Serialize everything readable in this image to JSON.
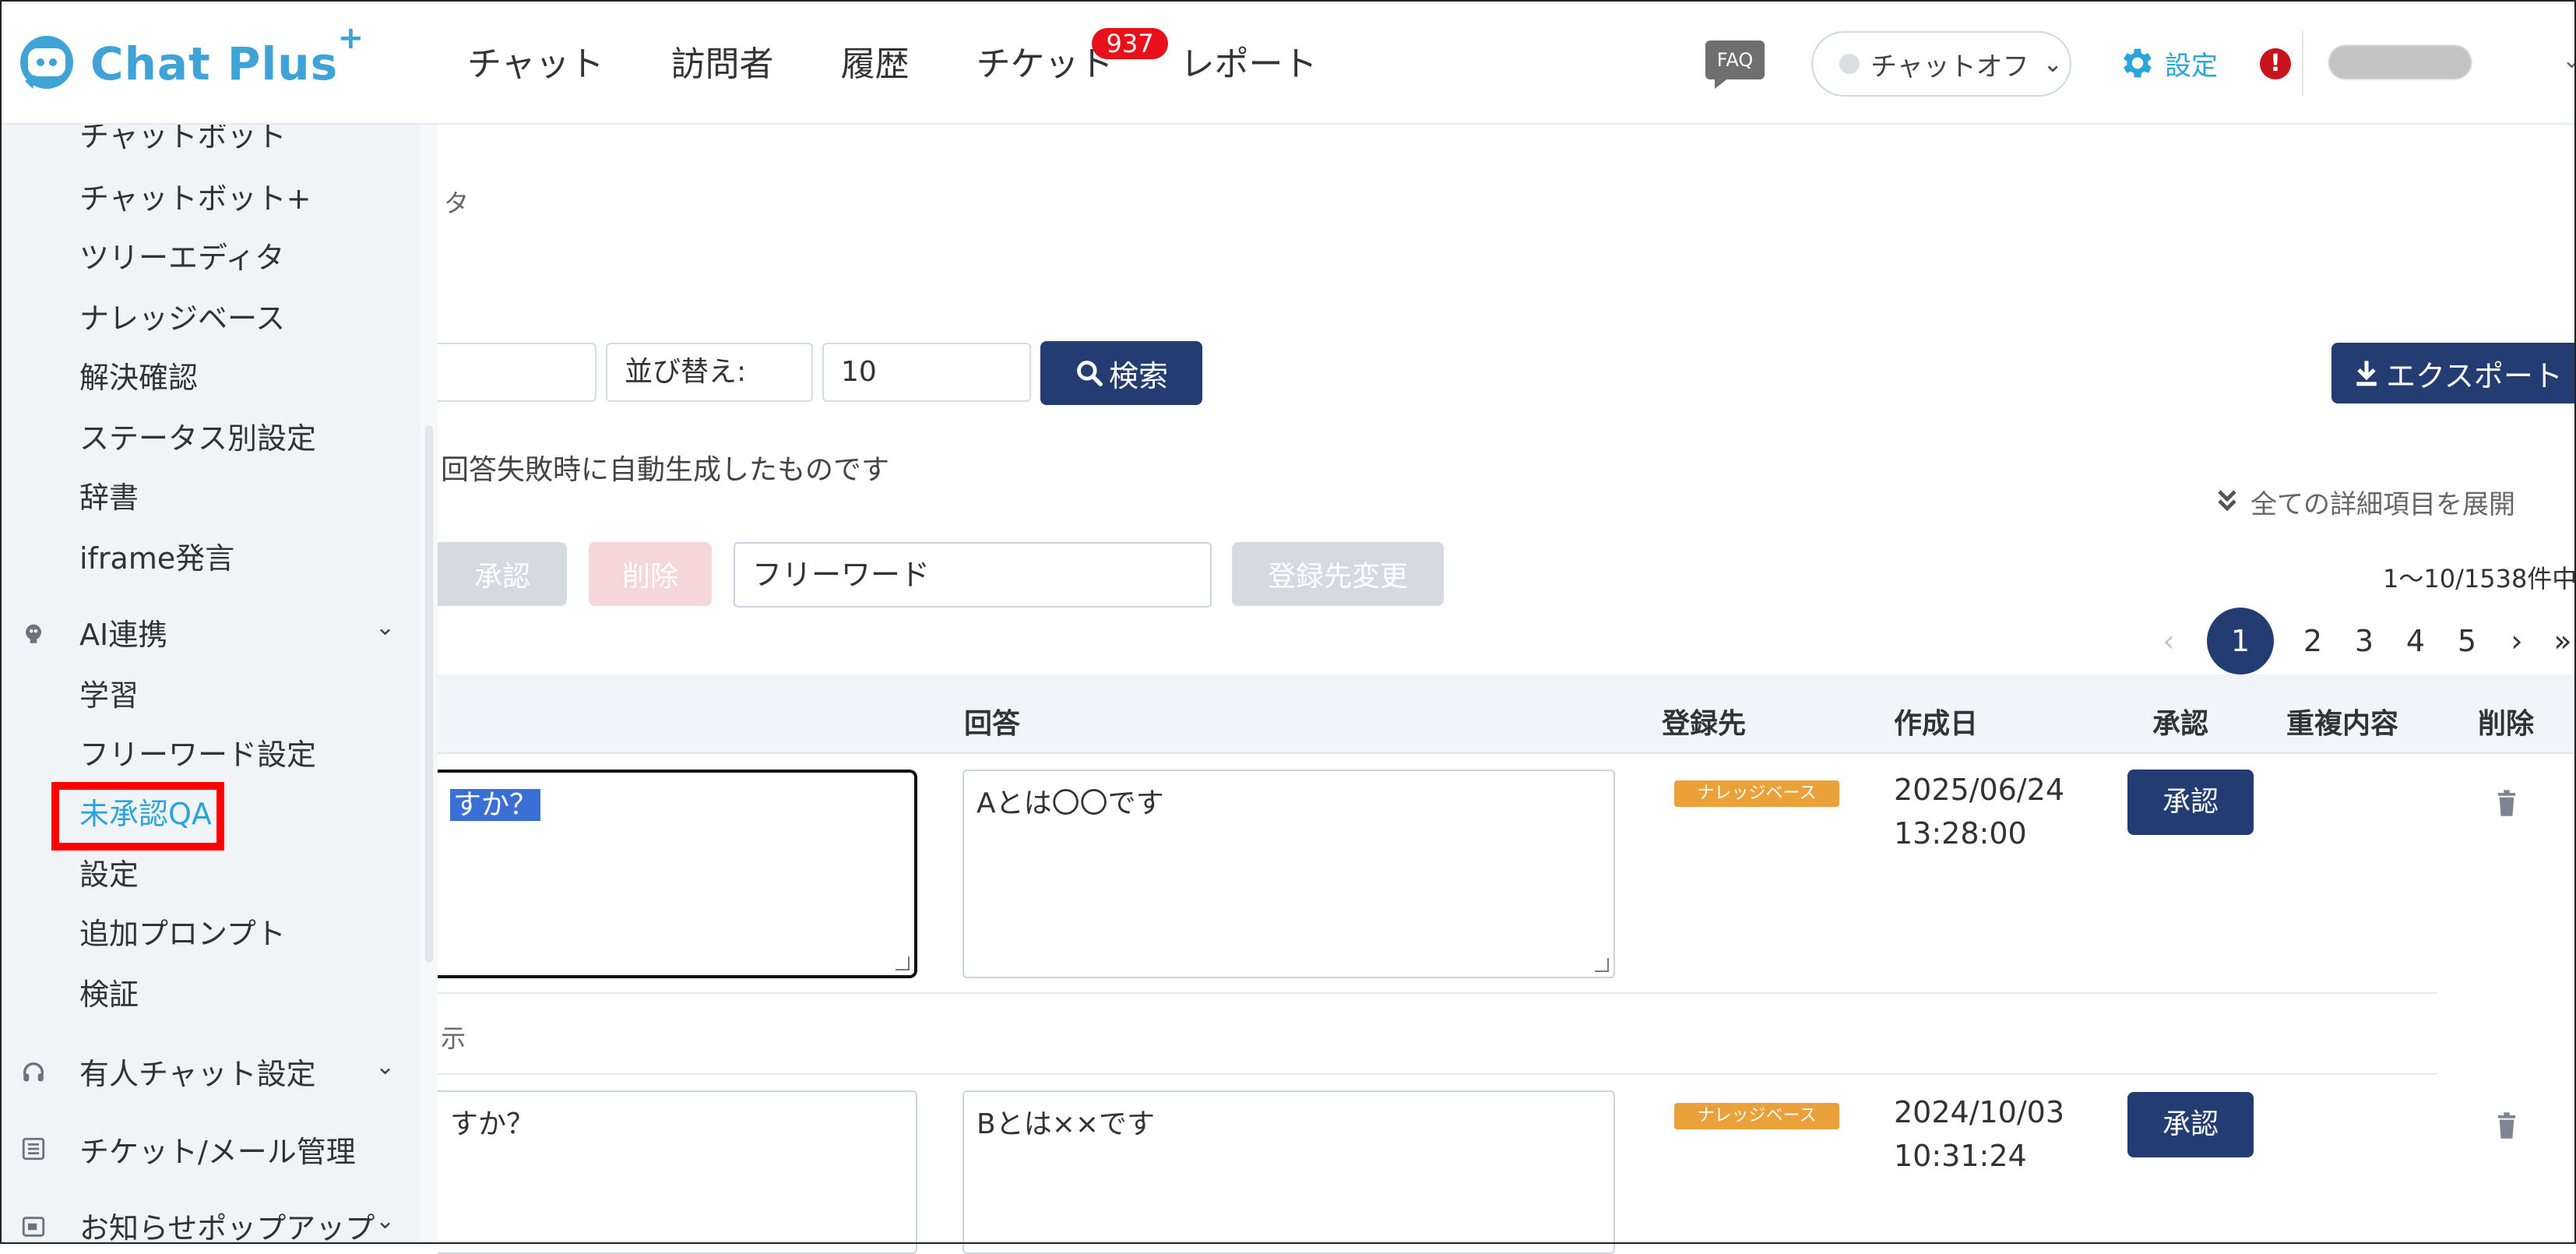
{
  "header": {
    "logo_text": "Chat Plus",
    "logo_sup": "+",
    "nav": [
      "チャット",
      "訪問者",
      "履歴",
      "チケット",
      "レポート"
    ],
    "ticket_badge": "937",
    "faq_label": "FAQ",
    "status_label": "チャットオフ",
    "settings_label": "設定",
    "alert_symbol": "!"
  },
  "sidebar": {
    "chatbot_items": [
      "チャットボット",
      "チャットボット+",
      "ツリーエディタ",
      "ナレッジベース",
      "解決確認",
      "ステータス別設定",
      "辞書",
      "iframe発言"
    ],
    "ai_group": "AI連携",
    "ai_items": [
      "学習",
      "フリーワード設定",
      "未承認QA",
      "設定",
      "追加プロンプト",
      "検証"
    ],
    "active_item": "未承認QA",
    "groups_below": [
      "有人チャット設定",
      "チケット/メール管理",
      "お知らせポップアップ"
    ]
  },
  "main": {
    "breadcrumb_fragment": "タ",
    "sort_label": "並び替え:",
    "per_page_value": "10",
    "search_button": "検索",
    "export_button": "エクスポート",
    "note": "回答失敗時に自動生成したものです",
    "expand_all": "全ての詳細項目を展開",
    "bulk_approve": "承認",
    "bulk_delete": "削除",
    "freeword_value": "フリーワード",
    "change_dest": "登録先変更",
    "count": "1〜10/1538件中",
    "pager": {
      "prev": "‹",
      "current": "1",
      "pages": [
        "2",
        "3",
        "4",
        "5"
      ],
      "next": "›",
      "last": "»"
    },
    "columns": [
      "回答",
      "登録先",
      "作成日",
      "承認",
      "重複内容",
      "削除"
    ],
    "rows": [
      {
        "question_fragment": "すか？",
        "answer": "Aとは〇〇です",
        "dest": "ナレッジベース",
        "date": "2025/06/24",
        "time": "13:28:00",
        "approve": "承認"
      },
      {
        "question_fragment": "すか？",
        "answer": "Bとは××です",
        "dest": "ナレッジベース",
        "date": "2024/10/03",
        "time": "10:31:24",
        "approve": "承認"
      }
    ],
    "row_toggle": "示"
  },
  "colors": {
    "brand": "#3fa3d8",
    "primary": "#233d73",
    "tag": "#eaa13a",
    "highlight": "#ff0000",
    "badge": "#e8101a"
  }
}
